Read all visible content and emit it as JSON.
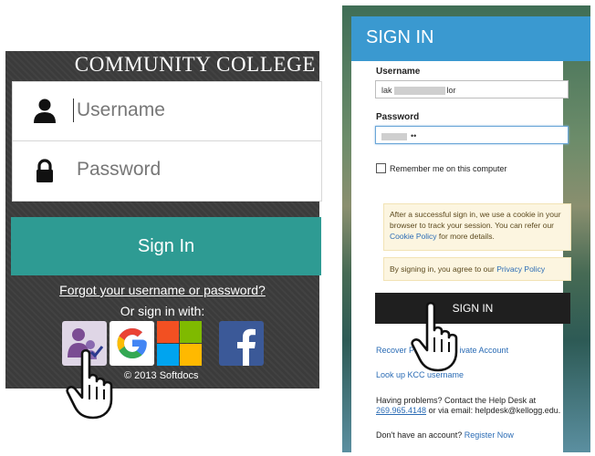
{
  "left_panel": {
    "college_name": "COMMUNITY COLLEGE",
    "username_placeholder": "Username",
    "password_placeholder": "Password",
    "signin_label": "Sign In",
    "forgot_link": "Forgot your username or password?",
    "or_sign_in_with": "Or sign in with:",
    "providers": [
      "people-icon",
      "google-icon",
      "microsoft-icon",
      "facebook-icon"
    ],
    "copyright": "© 2013 Softdocs",
    "colors": {
      "background": "#3b3b3b",
      "signin_button": "#2e9b93"
    }
  },
  "right_panel": {
    "header_title": "SIGN IN",
    "username_label": "Username",
    "username_value_start": "lak",
    "username_value_end": "lor",
    "password_label": "Password",
    "password_value": "••",
    "remember_label": "Remember me on this computer",
    "cookie_note_prefix": "After a successful sign in, we use a cookie in your browser to track your session. You can refer our ",
    "cookie_policy_link": "Cookie Policy",
    "cookie_note_suffix": " for more details.",
    "privacy_prefix": "By signing in, you agree to our ",
    "privacy_link": "Privacy Policy",
    "signin_label": "SIGN IN",
    "recover_prefix": "Recover Pas",
    "recover_suffix": "ivate Account",
    "lookup_link": "Look up KCC username",
    "help_text": "Having problems? Contact the Help Desk at",
    "help_phone": "269.965.4148",
    "help_email_text": " or via email: helpdesk@kellogg.edu.",
    "no_account_text": "Don't have an account? ",
    "register_link": "Register Now",
    "colors": {
      "header": "#3a99d0",
      "signin_button": "#1f1f1f",
      "link": "#2b6cb5"
    }
  }
}
